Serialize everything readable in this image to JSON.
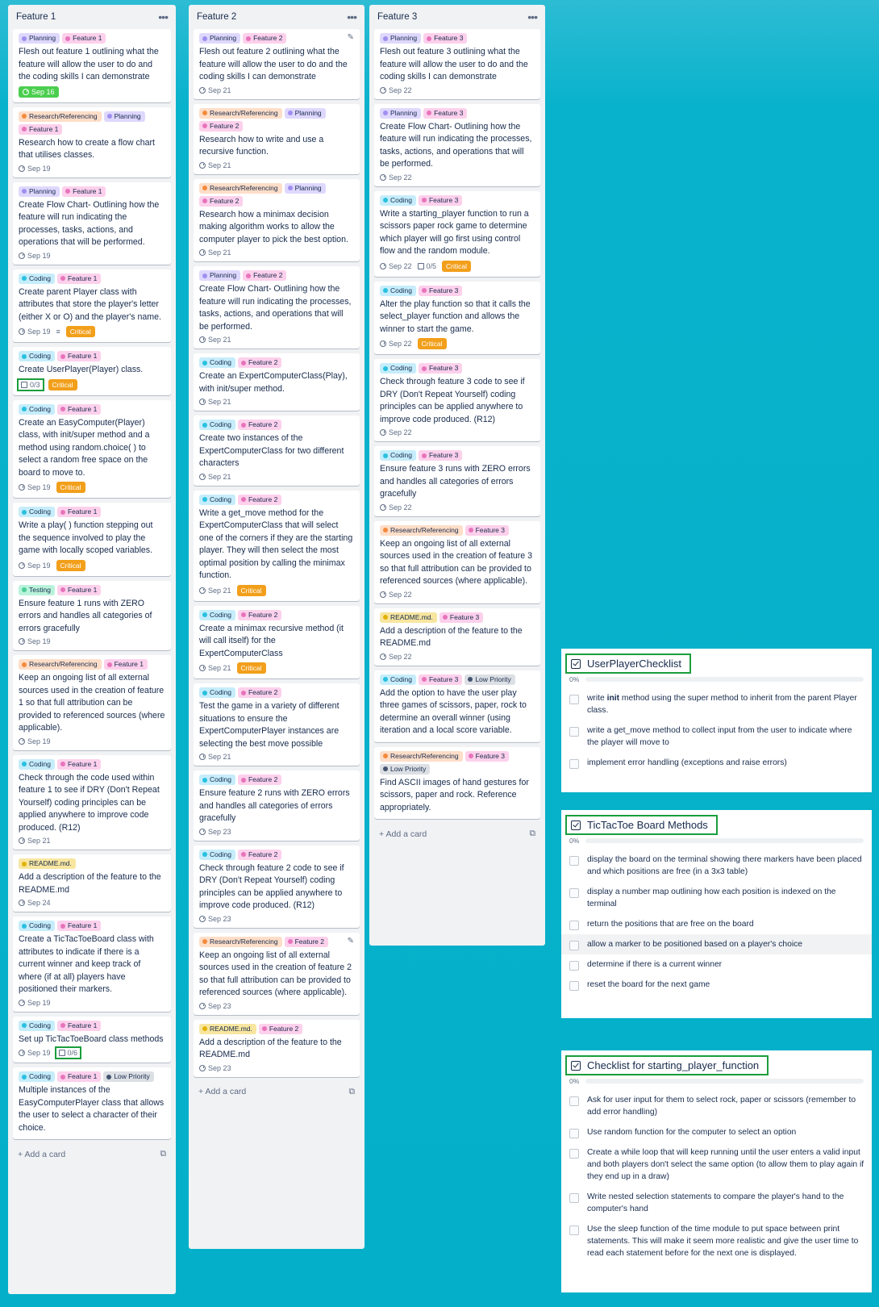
{
  "colors": {
    "Planning": {
      "bg": "#dfd8fd",
      "dot": "#9f8fef"
    },
    "Feature 1": {
      "bg": "#fdd0ec",
      "dot": "#e774bb"
    },
    "Feature 2": {
      "bg": "#fdd0ec",
      "dot": "#e774bb"
    },
    "Feature 3": {
      "bg": "#fdd0ec",
      "dot": "#e774bb"
    },
    "Research/Referencing": {
      "bg": "#fedec8",
      "dot": "#f38a3c"
    },
    "Coding": {
      "bg": "#c6edfb",
      "dot": "#29c1e0"
    },
    "Testing": {
      "bg": "#baf3db",
      "dot": "#4bce97"
    },
    "README.md.": {
      "bg": "#f8e6a0",
      "dot": "#e2b203"
    },
    "Low Priority": {
      "bg": "#dcdfe4",
      "dot": "#44546f"
    }
  },
  "lists": [
    {
      "title": "Feature 1",
      "add_card": "Add a card",
      "cards": [
        {
          "labels": [
            "Planning",
            "Feature 1"
          ],
          "title": "Flesh out feature 1 outlining what the feature will allow the user to do and the coding skills I can demonstrate",
          "due": "Sep 16",
          "due_style": "green"
        },
        {
          "labels": [
            "Research/Referencing",
            "Planning",
            "Feature 1"
          ],
          "title": "Research how to create a flow chart that utilises classes.",
          "due": "Sep 19"
        },
        {
          "labels": [
            "Planning",
            "Feature 1"
          ],
          "title": "Create Flow Chart- Outlining how the feature will run indicating the processes, tasks, actions, and operations that will be performed.",
          "due": "Sep 19"
        },
        {
          "labels": [
            "Coding",
            "Feature 1"
          ],
          "title": "Create parent Player class with attributes that store the player's letter (either X or O) and the player's name.",
          "due": "Sep 19",
          "description": true,
          "critical": "Critical"
        },
        {
          "labels": [
            "Coding",
            "Feature 1"
          ],
          "title": "Create UserPlayer(Player) class.",
          "checklist": "0/3",
          "checklist_boxed": true,
          "critical": "Critical"
        },
        {
          "labels": [
            "Coding",
            "Feature 1"
          ],
          "title": "Create an EasyComputer(Player) class, with init/super method and a method using random.choice( ) to select a random free space on the board to move to.",
          "due": "Sep 19",
          "critical": "Critical"
        },
        {
          "labels": [
            "Coding",
            "Feature 1"
          ],
          "title": "Write a play( ) function stepping out the sequence involved to play the game with locally scoped variables.",
          "due": "Sep 19",
          "critical": "Critical"
        },
        {
          "labels": [
            "Testing",
            "Feature 1"
          ],
          "title": "Ensure feature 1 runs with ZERO errors and handles all categories of errors gracefully",
          "due": "Sep 19"
        },
        {
          "labels": [
            "Research/Referencing",
            "Feature 1"
          ],
          "title": "Keep an ongoing list of all external sources used in the creation of feature 1 so that full attribution can be provided to referenced sources (where applicable).",
          "due": "Sep 19"
        },
        {
          "labels": [
            "Coding",
            "Feature 1"
          ],
          "title": "Check through the code used within feature 1 to see if DRY (Don't Repeat Yourself) coding principles can be applied anywhere to improve code produced. (R12)",
          "due": "Sep 21"
        },
        {
          "labels": [
            "README.md."
          ],
          "title": "Add a description of the feature to the README.md",
          "due": "Sep 24"
        },
        {
          "labels": [
            "Coding",
            "Feature 1"
          ],
          "title": "Create a TicTacToeBoard class with attributes to indicate if there is a current winner and keep track of where (if at all) players have positioned their markers.",
          "due": "Sep 19"
        },
        {
          "labels": [
            "Coding",
            "Feature 1"
          ],
          "title": "Set up TicTacToeBoard class methods",
          "due": "Sep 19",
          "checklist": "0/6",
          "checklist_boxed": true
        },
        {
          "labels": [
            "Coding",
            "Feature 1",
            "Low Priority"
          ],
          "title": "Multiple instances of the EasyComputerPlayer class that allows the user to select a character of their choice."
        }
      ]
    },
    {
      "title": "Feature 2",
      "add_card": "Add a card",
      "cards": [
        {
          "labels": [
            "Planning",
            "Feature 2"
          ],
          "title": "Flesh out feature 2 outlining what the feature will allow the user to do and the coding skills I can demonstrate",
          "due": "Sep 21",
          "pencil": true
        },
        {
          "labels": [
            "Research/Referencing",
            "Planning",
            "Feature 2"
          ],
          "title": "Research how to write and use a recursive function.",
          "due": "Sep 21"
        },
        {
          "labels": [
            "Research/Referencing",
            "Planning",
            "Feature 2"
          ],
          "title": "Research how a minimax decision making algorithm works to allow the computer player to pick the best option.",
          "due": "Sep 21"
        },
        {
          "labels": [
            "Planning",
            "Feature 2"
          ],
          "title": "Create Flow Chart- Outlining how the feature will run indicating the processes, tasks, actions, and operations that will be performed.",
          "due": "Sep 21"
        },
        {
          "labels": [
            "Coding",
            "Feature 2"
          ],
          "title": "Create an ExpertComputerClass(Play), with init/super method.",
          "due": "Sep 21"
        },
        {
          "labels": [
            "Coding",
            "Feature 2"
          ],
          "title": "Create two instances of the ExpertComputerClass for two different characters",
          "due": "Sep 21"
        },
        {
          "labels": [
            "Coding",
            "Feature 2"
          ],
          "title": "Write a get_move method for the ExpertComputerClass that will select one of the corners if they are the starting player. They will then select the most optimal position by calling the minimax function.",
          "due": "Sep 21",
          "critical": "Critical"
        },
        {
          "labels": [
            "Coding",
            "Feature 2"
          ],
          "title": "Create a minimax recursive method (it will call itself) for the ExpertComputerClass",
          "due": "Sep 21",
          "critical": "Critical"
        },
        {
          "labels": [
            "Coding",
            "Feature 2"
          ],
          "title": "Test the game in a variety of different situations to ensure the ExpertComputerPlayer instances are selecting the best move possible",
          "due": "Sep 21"
        },
        {
          "labels": [
            "Coding",
            "Feature 2"
          ],
          "title": "Ensure feature 2 runs with ZERO errors and handles all categories of errors gracefully",
          "due": "Sep 23"
        },
        {
          "labels": [
            "Coding",
            "Feature 2"
          ],
          "title": "Check through feature 2 code to see if DRY (Don't Repeat Yourself) coding principles can be applied anywhere to improve code produced. (R12)",
          "due": "Sep 23"
        },
        {
          "labels": [
            "Research/Referencing",
            "Feature 2"
          ],
          "title": "Keep an ongoing list of all external sources used in the creation of feature 2 so that full attribution can be provided to referenced sources (where applicable).",
          "due": "Sep 23",
          "pencil": true
        },
        {
          "labels": [
            "README.md.",
            "Feature 2"
          ],
          "title": "Add a description of the feature to the README.md",
          "due": "Sep 23"
        }
      ]
    },
    {
      "title": "Feature 3",
      "add_card": "Add a card",
      "cards": [
        {
          "labels": [
            "Planning",
            "Feature 3"
          ],
          "title": "Flesh out feature 3 outlining what the feature will allow the user to do and the coding skills I can demonstrate",
          "due": "Sep 22"
        },
        {
          "labels": [
            "Planning",
            "Feature 3"
          ],
          "title": "Create Flow Chart- Outlining how the feature will run indicating the processes, tasks, actions, and operations that will be performed.",
          "due": "Sep 22"
        },
        {
          "labels": [
            "Coding",
            "Feature 3"
          ],
          "title": "Write a starting_player function to run a scissors paper rock game to determine which player will go first using control flow and the random module.",
          "due": "Sep 22",
          "checklist": "0/5",
          "critical": "Critical"
        },
        {
          "labels": [
            "Coding",
            "Feature 3"
          ],
          "title": "Alter the play function so that it calls the select_player function and allows the winner to start the game.",
          "due": "Sep 22",
          "critical": "Critical"
        },
        {
          "labels": [
            "Coding",
            "Feature 3"
          ],
          "title": "Check through feature 3 code to see if DRY (Don't Repeat Yourself) coding principles can be applied anywhere to improve code produced. (R12)",
          "due": "Sep 22"
        },
        {
          "labels": [
            "Coding",
            "Feature 3"
          ],
          "title": "Ensure feature 3 runs with ZERO errors and handles all categories of errors gracefully",
          "due": "Sep 22"
        },
        {
          "labels": [
            "Research/Referencing",
            "Feature 3"
          ],
          "title": "Keep an ongoing list of all external sources used in the creation of feature 3 so that full attribution can be provided to referenced sources (where applicable).",
          "due": "Sep 22"
        },
        {
          "labels": [
            "README.md.",
            "Feature 3"
          ],
          "title": "Add a description of the feature to the README.md",
          "due": "Sep 22"
        },
        {
          "labels": [
            "Coding",
            "Feature 3",
            "Low Priority"
          ],
          "title": "Add the option to have the user play three games of scissors, paper, rock to determine an overall winner (using iteration and a local score variable."
        },
        {
          "labels": [
            "Research/Referencing",
            "Feature 3",
            "Low Priority"
          ],
          "title": "Find ASCII images of hand gestures for scissors, paper and rock. Reference appropriately."
        }
      ]
    }
  ],
  "checklists": [
    {
      "title": "UserPlayerChecklist",
      "progress": "0%",
      "items": [
        {
          "html": "write <b>init</b> method using the super method to inherit from the parent Player class."
        },
        {
          "text": "write a get_move method to collect input from the user to indicate where the player will move to"
        },
        {
          "text": "implement error handling (exceptions and raise errors)"
        }
      ]
    },
    {
      "title": "TicTacToe Board Methods",
      "progress": "0%",
      "items": [
        {
          "text": "display the board on the terminal showing there markers have been placed and which positions are free (in a 3x3 table)"
        },
        {
          "text": "display a number map outlining how each position is indexed on the terminal"
        },
        {
          "text": "return the positions that are free on the board"
        },
        {
          "text": "allow a marker to be positioned based on a player's choice",
          "highlight": true
        },
        {
          "text": "determine if there is a current winner"
        },
        {
          "text": "reset the board for the next game"
        }
      ]
    },
    {
      "title": "Checklist for starting_player_function",
      "progress": "0%",
      "items": [
        {
          "text": "Ask for user input for them to select rock, paper or scissors (remember to add error handling)"
        },
        {
          "text": "Use random function for the computer to select an option"
        },
        {
          "text": "Create a while loop that will keep running until the user enters a valid input and both players don't select the same option (to allow them to play again if they end up in a draw)"
        },
        {
          "text": "Write nested selection statements to compare the player's hand to the computer's hand"
        },
        {
          "text": "Use the sleep function of the time module to put space between print statements. This will make it seem more realistic and give the user time to read each statement before for the next one is displayed."
        }
      ]
    }
  ]
}
